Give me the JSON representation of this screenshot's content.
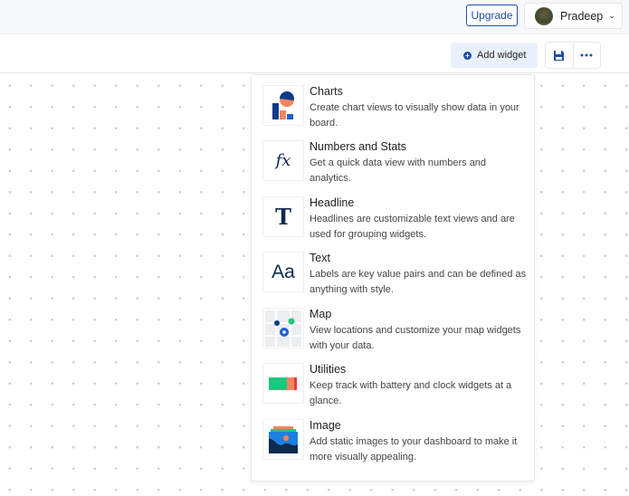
{
  "header": {
    "upgrade_label": "Upgrade",
    "user_name": "Pradeep"
  },
  "toolbar": {
    "add_widget_label": "Add widget"
  },
  "menu": {
    "items": [
      {
        "title": "Charts",
        "description": "Create chart views to visually show data in your board."
      },
      {
        "title": "Numbers and Stats",
        "description": "Get a quick data view with numbers and analytics."
      },
      {
        "title": "Headline",
        "description": "Headlines are customizable text views and are used for grouping widgets."
      },
      {
        "title": "Text",
        "description": "Labels are key value pairs and can be defined as anything with style."
      },
      {
        "title": "Map",
        "description": "View locations and customize your map widgets with your data."
      },
      {
        "title": "Utilities",
        "description": "Keep track with battery and clock widgets at a glance."
      },
      {
        "title": "Image",
        "description": "Add static images to your dashboard to make it more visually appealing."
      }
    ]
  },
  "icons": {
    "fx": "fx",
    "headline": "T",
    "text": "Aa"
  },
  "colors": {
    "accent": "#1d4ea8",
    "orange": "#f4845f",
    "green": "#1fc67f",
    "navy": "#0d2a4f"
  }
}
